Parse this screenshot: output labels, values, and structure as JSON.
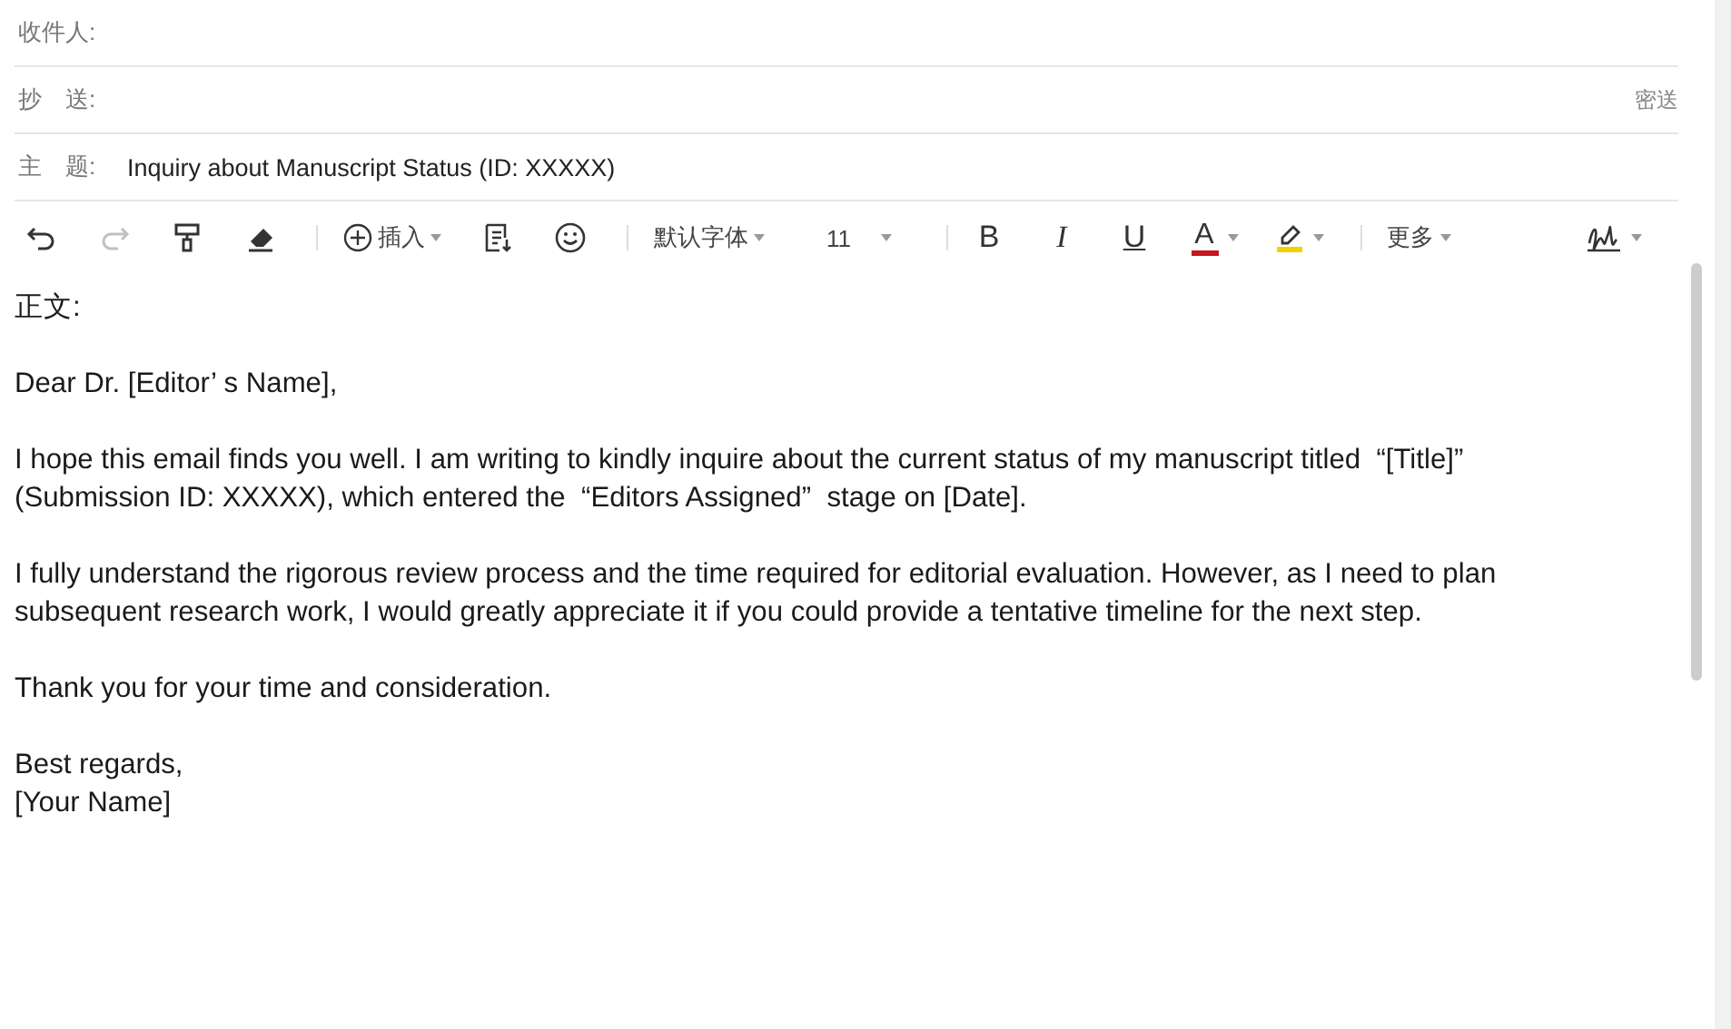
{
  "header_fields": [
    {
      "kind": "recipient",
      "label": "收件人:"
    },
    {
      "kind": "cc",
      "label": "抄　送:",
      "link": "密送"
    },
    {
      "kind": "subject",
      "label": "主　题:",
      "value": "Inquiry about Manuscript Status (ID: XXXXX)"
    }
  ],
  "toolbar": [
    {
      "kind": "undo",
      "disabled": false
    },
    {
      "kind": "redo",
      "disabled": true
    },
    {
      "kind": "brush",
      "disabled": false
    },
    {
      "kind": "eraser",
      "disabled": false
    },
    {
      "kind": "separator"
    },
    {
      "kind": "insert",
      "label": "插入"
    },
    {
      "kind": "doc",
      "disabled": false
    },
    {
      "kind": "smile",
      "disabled": false
    },
    {
      "kind": "separator"
    },
    {
      "kind": "menu",
      "label": "默认字体"
    },
    {
      "kind": "size",
      "label": "11"
    },
    {
      "kind": "separator"
    },
    {
      "kind": "bold",
      "label": "B"
    },
    {
      "kind": "italic",
      "label": "I"
    },
    {
      "kind": "underline",
      "label": "U"
    },
    {
      "kind": "fontcolor",
      "label": "A",
      "color": "#c8161d"
    },
    {
      "kind": "highlight",
      "color": "#f5d000"
    },
    {
      "kind": "separator"
    },
    {
      "kind": "menu",
      "label": "更多"
    },
    {
      "kind": "spacer"
    },
    {
      "kind": "signature"
    }
  ],
  "body": {
    "label": "正文:",
    "paragraphs": [
      "Dear Dr. [Editor’ s Name],",
      "I hope this email finds you well. I am writing to kindly inquire about the current status of my manuscript titled  “[Title]” (Submission ID: XXXXX), which entered the  “Editors Assigned”  stage on [Date].",
      "I fully understand the rigorous review process and the time required for editorial evaluation. However, as I need to plan subsequent research work, I would greatly appreciate it if you could provide a tentative timeline for the next step.",
      "Thank you for your time and consideration.",
      "Best regards,\n[Your Name]"
    ]
  }
}
